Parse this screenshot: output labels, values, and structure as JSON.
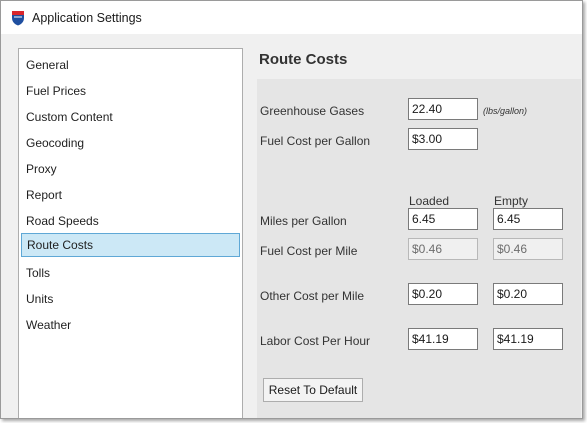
{
  "window": {
    "title": "Application Settings"
  },
  "sidebar": {
    "items": [
      {
        "label": "General"
      },
      {
        "label": "Fuel Prices"
      },
      {
        "label": "Custom Content"
      },
      {
        "label": "Geocoding"
      },
      {
        "label": "Proxy"
      },
      {
        "label": "Report"
      },
      {
        "label": "Road Speeds"
      },
      {
        "label": "Route Costs",
        "selected": true
      },
      {
        "label": "Tolls"
      },
      {
        "label": "Units"
      },
      {
        "label": "Weather"
      }
    ]
  },
  "panel": {
    "title": "Route Costs",
    "greenhouse": {
      "label": "Greenhouse Gases",
      "value": "22.40",
      "unit": "(lbs/gallon)"
    },
    "fuel_cost_gallon": {
      "label": "Fuel Cost per Gallon",
      "value": "$3.00"
    },
    "columns": {
      "loaded": "Loaded",
      "empty": "Empty"
    },
    "mpg": {
      "label": "Miles per Gallon",
      "loaded": "6.45",
      "empty": "6.45"
    },
    "fuel_cost_mile": {
      "label": "Fuel Cost per Mile",
      "loaded": "$0.46",
      "empty": "$0.46"
    },
    "other_cost_mile": {
      "label": "Other Cost per Mile",
      "loaded": "$0.20",
      "empty": "$0.20"
    },
    "labor_cost_hour": {
      "label": "Labor Cost Per Hour",
      "loaded": "$41.19",
      "empty": "$41.19"
    },
    "reset_label": "Reset To Default"
  },
  "colors": {
    "selection_bg": "#cce8f6",
    "selection_border": "#5fa8d6",
    "window_bg": "#f0f0f0",
    "panel_box": "#e5e5e5"
  }
}
